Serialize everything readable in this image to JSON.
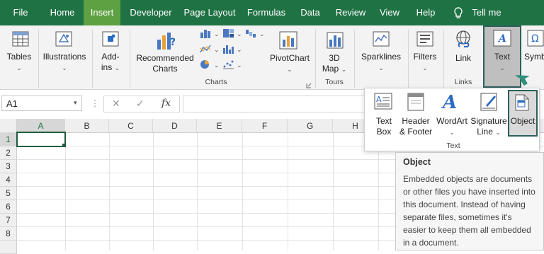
{
  "tabs": [
    "File",
    "Home",
    "Insert",
    "Developer",
    "Page Layout",
    "Formulas",
    "Data",
    "Review",
    "View",
    "Help",
    "Tell me"
  ],
  "active_tab": "Insert",
  "ribbon": {
    "tables": {
      "line1": "Tables"
    },
    "illustrations": {
      "line1": "Illustrations"
    },
    "addins": {
      "line1": "Add-",
      "line2": "ins"
    },
    "recommended": {
      "line1": "Recommended",
      "line2": "Charts"
    },
    "pivotchart": {
      "line1": "PivotChart"
    },
    "map3d": {
      "line1": "3D",
      "line2": "Map"
    },
    "sparklines": {
      "line1": "Sparklines"
    },
    "filters": {
      "line1": "Filters"
    },
    "link": {
      "line1": "Link"
    },
    "text": {
      "line1": "Text"
    },
    "symbols": {
      "line1": "Symb"
    },
    "groups": {
      "charts": "Charts",
      "tours": "Tours",
      "links": "Links"
    }
  },
  "formula_bar": {
    "name_box": "A1",
    "fx": "fx",
    "cancel": "✕",
    "enter": "✓"
  },
  "columns": [
    "A",
    "B",
    "C",
    "D",
    "E",
    "F",
    "G",
    "H"
  ],
  "rows": [
    "1",
    "2",
    "3",
    "4",
    "5",
    "6",
    "7",
    "8"
  ],
  "text_panel": {
    "items": [
      {
        "line1": "Text",
        "line2": "Box"
      },
      {
        "line1": "Header",
        "line2": "& Footer"
      },
      {
        "line1": "WordArt",
        "line2": ""
      },
      {
        "line1": "Signature",
        "line2": "Line"
      },
      {
        "line1": "Object",
        "line2": ""
      }
    ],
    "group_label": "Text"
  },
  "tooltip": {
    "title": "Object",
    "body": "Embedded objects are documents or other files you have inserted into this document. Instead of having separate files, sometimes it's easier to keep them all embedded in a document."
  },
  "colors": {
    "tabbar": "#1f7244",
    "active_tab": "#5da142",
    "accent": "#2e5f5c"
  }
}
